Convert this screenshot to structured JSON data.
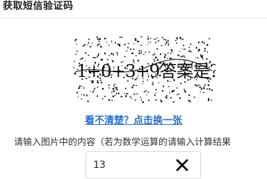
{
  "dialog": {
    "title": "获取短信验证码"
  },
  "captcha": {
    "text": "1+0+3+9答案是?"
  },
  "refresh_link": "看不清楚？点击换一张",
  "instruction": "请输入图片中的内容（若为数学运算的请输入计算结果",
  "answer": {
    "value": "13",
    "clear_icon": "close-icon"
  }
}
